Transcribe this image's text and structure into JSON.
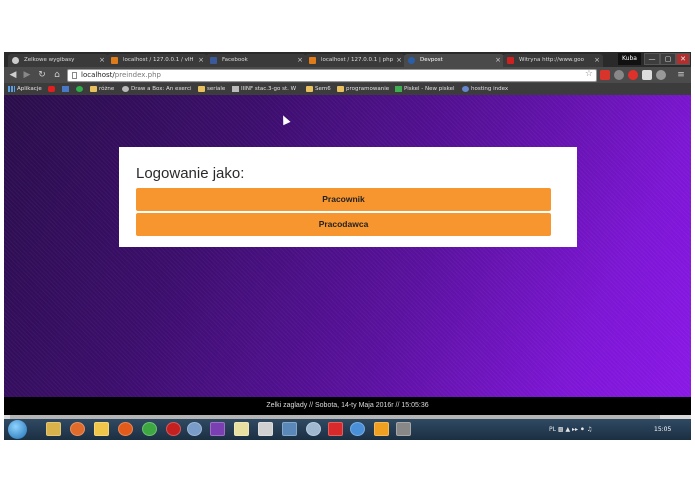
{
  "browser": {
    "tabs": [
      {
        "label": "Zelkowe wygibasy",
        "icon_color": "#cccccc",
        "active": false
      },
      {
        "label": "localhost / 127.0.0.1 / vlH",
        "icon_color": "#e07b1a",
        "active": false
      },
      {
        "label": "Facebook",
        "icon_color": "#3b5998",
        "active": false
      },
      {
        "label": "localhost / 127.0.0.1 | php",
        "icon_color": "#e07b1a",
        "active": false
      },
      {
        "label": "Devpost",
        "icon_color": "#2b5ea8",
        "active": true
      },
      {
        "label": "Witryna http://www.goo",
        "icon_color": "#cc2222",
        "active": false
      }
    ],
    "tab_close": "×",
    "user": "Kuba",
    "window_buttons": [
      "—",
      "▢",
      "✕"
    ],
    "url_host": "localhost/",
    "url_path": "preindex.php"
  },
  "bookmarks": [
    {
      "label": "Aplikacje",
      "icon": "apps-icon"
    },
    {
      "label": "",
      "icon": "youtube-icon"
    },
    {
      "label": "",
      "icon": "app-icon"
    },
    {
      "label": "",
      "icon": "green-icon"
    },
    {
      "label": "różne",
      "icon": "folder-icon"
    },
    {
      "label": "Draw a Box: An exerci",
      "icon": "page-icon"
    },
    {
      "label": "seriale",
      "icon": "folder-icon"
    },
    {
      "label": "IIINF stac.3-go st. W",
      "icon": "page-icon"
    },
    {
      "label": "Sem6",
      "icon": "folder-icon"
    },
    {
      "label": "programowanie",
      "icon": "folder-icon"
    },
    {
      "label": "Piskel - New piskel",
      "icon": "piskel-icon"
    },
    {
      "label": "hosting index",
      "icon": "page-icon"
    }
  ],
  "login": {
    "title": "Logowanie jako:",
    "buttons": [
      "Pracownik",
      "Pracodawca"
    ]
  },
  "footer": "Zelki zaglady // Sobota, 14-ty Maja 2016r // 15:05:36",
  "taskbar": {
    "tray_lang": "PL",
    "clock": "15:05"
  },
  "colors": {
    "accent": "#f7962f",
    "background_start": "#2a0d4a",
    "background_end": "#8a18e6"
  }
}
